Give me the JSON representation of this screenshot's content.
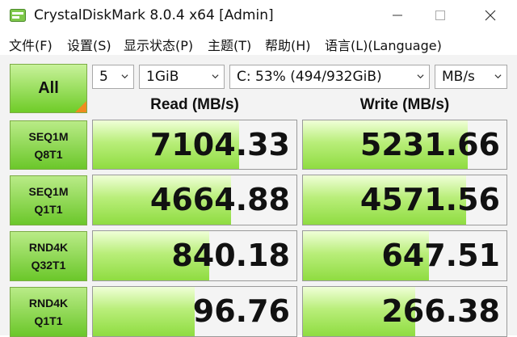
{
  "window": {
    "title": "CrystalDiskMark 8.0.4 x64 [Admin]",
    "icon": "crystaldiskmark-app-icon",
    "controls": [
      "minimize",
      "maximize",
      "close"
    ]
  },
  "menu": {
    "items": [
      {
        "label": "文件(F)"
      },
      {
        "label": "设置(S)"
      },
      {
        "label": "显示状态(P)"
      },
      {
        "label": "主题(T)"
      },
      {
        "label": "帮助(H)"
      },
      {
        "label": "语言(L)(Language)"
      }
    ]
  },
  "toolbar": {
    "all_label": "All",
    "count": "5",
    "size": "1GiB",
    "drive": "C: 53% (494/932GiB)",
    "unit": "MB/s"
  },
  "headers": {
    "read": "Read (MB/s)",
    "write": "Write (MB/s)"
  },
  "tests": [
    {
      "line1": "SEQ1M",
      "line2": "Q8T1",
      "read": "7104.33",
      "write": "5231.66",
      "read_fill": 0.72,
      "write_fill": 0.81
    },
    {
      "line1": "SEQ1M",
      "line2": "Q1T1",
      "read": "4664.88",
      "write": "4571.56",
      "read_fill": 0.68,
      "write_fill": 0.8
    },
    {
      "line1": "RND4K",
      "line2": "Q32T1",
      "read": "840.18",
      "write": "647.51",
      "read_fill": 0.57,
      "write_fill": 0.62
    },
    {
      "line1": "RND4K",
      "line2": "Q1T1",
      "read": "96.76",
      "write": "266.38",
      "read_fill": 0.5,
      "write_fill": 0.55
    }
  ],
  "colors": {
    "accent_green": "#6fcc28",
    "corner_orange": "#f08c1e"
  }
}
